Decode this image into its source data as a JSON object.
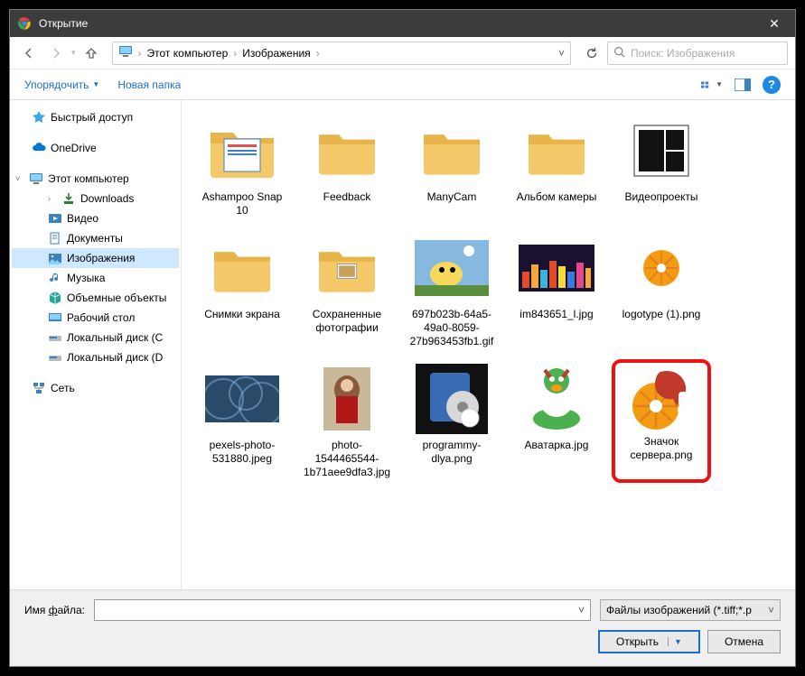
{
  "titlebar": {
    "title": "Открытие"
  },
  "nav": {
    "breadcrumb": [
      "Этот компьютер",
      "Изображения"
    ]
  },
  "search": {
    "placeholder": "Поиск: Изображения"
  },
  "toolbar": {
    "organize": "Упорядочить",
    "newfolder": "Новая папка"
  },
  "tree": {
    "quick_access": "Быстрый доступ",
    "onedrive": "OneDrive",
    "this_pc": "Этот компьютер",
    "downloads": "Downloads",
    "video": "Видео",
    "documents": "Документы",
    "images": "Изображения",
    "music": "Музыка",
    "objects3d": "Объемные объекты",
    "desktop": "Рабочий стол",
    "disk_c": "Локальный диск (C",
    "disk_d": "Локальный диск (D",
    "network": "Сеть"
  },
  "items": [
    {
      "name": "Ashampoo Snap 10",
      "type": "folder"
    },
    {
      "name": "Feedback",
      "type": "folder"
    },
    {
      "name": "ManyCam",
      "type": "folder"
    },
    {
      "name": "Альбом камеры",
      "type": "folder"
    },
    {
      "name": "Видеопроекты",
      "type": "folder-thumb"
    },
    {
      "name": "Снимки экрана",
      "type": "folder"
    },
    {
      "name": "Сохраненные фотографии",
      "type": "folder-small"
    },
    {
      "name": "697b023b-64a5-49a0-8059-27b963453fb1.gif",
      "type": "image"
    },
    {
      "name": "im843651_l.jpg",
      "type": "image"
    },
    {
      "name": "logotype (1).png",
      "type": "image"
    },
    {
      "name": "pexels-photo-531880.jpeg",
      "type": "image"
    },
    {
      "name": "photo-1544465544-1b71aee9dfa3.jpg",
      "type": "image"
    },
    {
      "name": "programmy-dlya.png",
      "type": "image"
    },
    {
      "name": "Аватарка.jpg",
      "type": "image"
    },
    {
      "name": "Значок сервера.png",
      "type": "image",
      "highlighted": true
    }
  ],
  "footer": {
    "filename_label_pre": "Имя ",
    "filename_label_u": "ф",
    "filename_label_post": "айла:",
    "filename_value": "",
    "filetype": "Файлы изображений (*.tiff;*.p",
    "open": "Открыть",
    "cancel": "Отмена"
  }
}
